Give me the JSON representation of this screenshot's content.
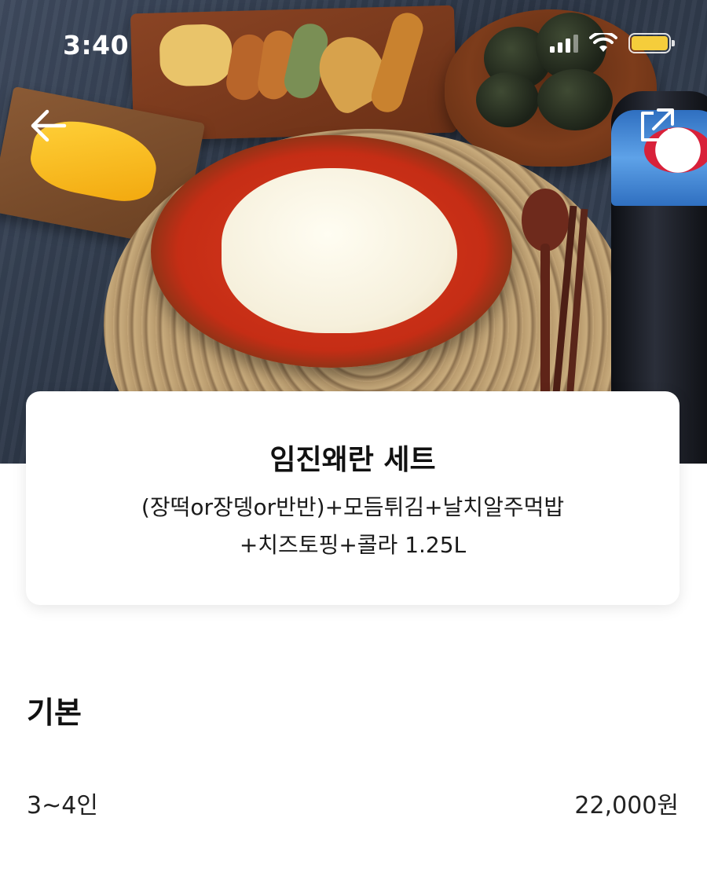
{
  "status_bar": {
    "time": "3:40"
  },
  "icons": {
    "back": "arrow-left-icon",
    "share": "share-icon",
    "signal": "cellular-signal-icon",
    "wifi": "wifi-icon",
    "battery": "battery-icon"
  },
  "colors": {
    "battery_fill": "#f5cd3b",
    "background": "#ffffff",
    "text_primary": "#111111"
  },
  "menu": {
    "title": "임진왜란 세트",
    "description_line1": "(장떡or장뎅or반반)+모듬튀김+날치알주먹밥",
    "description_line2": "+치즈토핑+콜라 1.25L"
  },
  "options": {
    "section_title": "기본",
    "items": [
      {
        "label": "3~4인",
        "price": "22,000원"
      }
    ]
  }
}
